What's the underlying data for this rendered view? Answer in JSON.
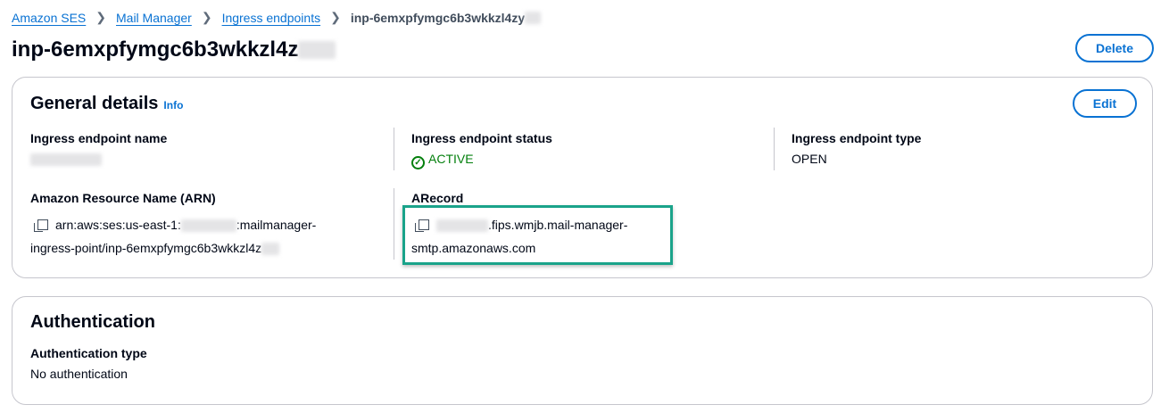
{
  "breadcrumbs": [
    {
      "label": "Amazon SES"
    },
    {
      "label": "Mail Manager"
    },
    {
      "label": "Ingress endpoints"
    },
    {
      "label": "inp-6emxpfymgc6b3wkkzl4zy"
    }
  ],
  "page": {
    "title": "inp-6emxpfymgc6b3wkkzl4z",
    "delete_label": "Delete"
  },
  "general": {
    "title": "General details",
    "info": "Info",
    "edit_label": "Edit",
    "name_label": "Ingress endpoint name",
    "status_label": "Ingress endpoint status",
    "status_value": "ACTIVE",
    "type_label": "Ingress endpoint type",
    "type_value": "OPEN",
    "arn_label": "Amazon Resource Name (ARN)",
    "arn_prefix": "arn:aws:ses:us-east-1:",
    "arn_mid": ":mailmanager-",
    "arn_line2": "ingress-point/inp-6emxpfymgc6b3wkkzl4z",
    "arecord_label": "ARecord",
    "arecord_line1": ".fips.wmjb.mail-manager-",
    "arecord_line2": "smtp.amazonaws.com"
  },
  "auth": {
    "title": "Authentication",
    "type_label": "Authentication type",
    "type_value": "No authentication"
  },
  "colors": {
    "accent": "#0972d3",
    "success": "#037f0c",
    "highlight": "#1aa38a"
  }
}
